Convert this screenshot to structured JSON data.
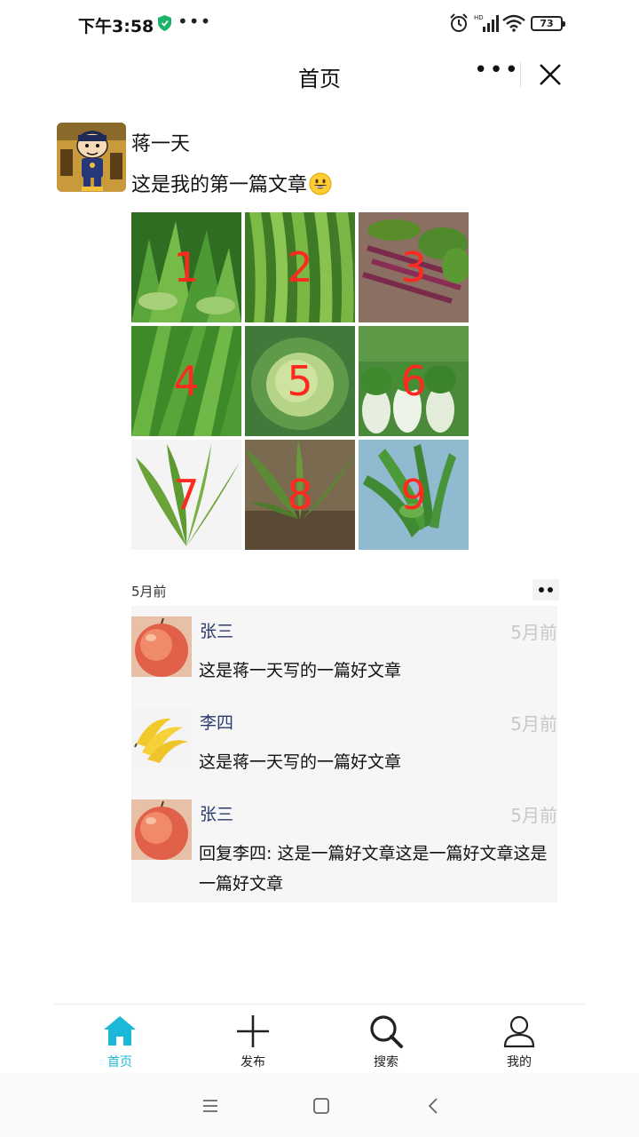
{
  "status": {
    "time": "下午3:58",
    "battery": "73"
  },
  "header": {
    "title": "首页",
    "more_icon": "more-dots-icon",
    "close_icon": "close-icon"
  },
  "post": {
    "author": "蒋一天",
    "text": "这是我的第一篇文章",
    "emoji": "grinning-face-emoji",
    "images": [
      {
        "label": "1",
        "bg": "#3f8f2e"
      },
      {
        "label": "2",
        "bg": "#5aa13a"
      },
      {
        "label": "3",
        "bg": "#7a5a55"
      },
      {
        "label": "4",
        "bg": "#4b9a2f"
      },
      {
        "label": "5",
        "bg": "#8ab85a"
      },
      {
        "label": "6",
        "bg": "#4f8c3a"
      },
      {
        "label": "7",
        "bg": "#f4f4f4"
      },
      {
        "label": "8",
        "bg": "#6a7a45"
      },
      {
        "label": "9",
        "bg": "#4c8f5a"
      }
    ],
    "time": "5月前"
  },
  "likes": {
    "icon": "heart-icon",
    "color": "#1cb8d8"
  },
  "comments": [
    {
      "name": "张三",
      "time": "5月前",
      "text": "这是蒋一天写的一篇好文章",
      "avatar": "apple"
    },
    {
      "name": "李四",
      "time": "5月前",
      "text": "这是蒋一天写的一篇好文章",
      "avatar": "banana"
    },
    {
      "name": "张三",
      "time": "5月前",
      "text": "回复李四: 这是一篇好文章这是一篇好文章这是一篇好文章",
      "avatar": "apple"
    }
  ],
  "tabs": [
    {
      "label": "首页",
      "icon": "home-icon",
      "active": true
    },
    {
      "label": "发布",
      "icon": "plus-icon",
      "active": false
    },
    {
      "label": "搜索",
      "icon": "search-icon",
      "active": false
    },
    {
      "label": "我的",
      "icon": "user-icon",
      "active": false
    }
  ],
  "colors": {
    "accent": "#1cb8d8",
    "number_overlay": "#ff2a1f"
  }
}
